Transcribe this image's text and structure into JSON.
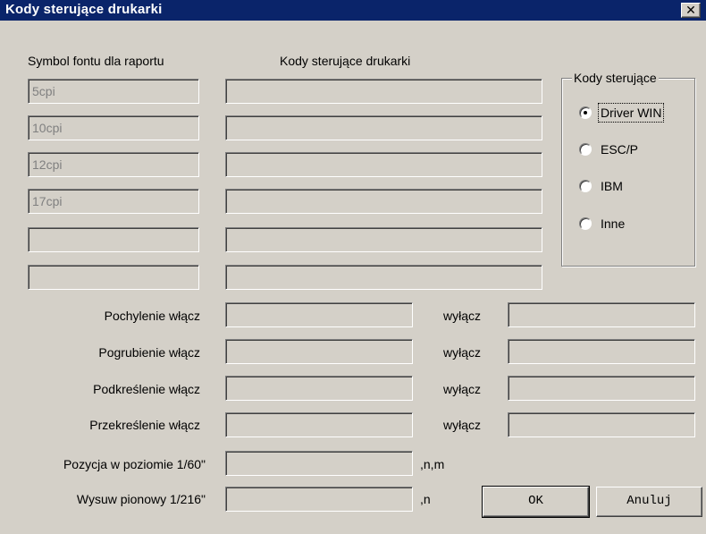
{
  "window": {
    "title": "Kody sterujące drukarki",
    "close_glyph": "✕"
  },
  "headers": {
    "symbol_col": "Symbol fontu dla raportu",
    "codes_col": "Kody sterujące drukarki"
  },
  "font_rows": [
    {
      "symbol": "5cpi",
      "code": ""
    },
    {
      "symbol": "10cpi",
      "code": ""
    },
    {
      "symbol": "12cpi",
      "code": ""
    },
    {
      "symbol": "17cpi",
      "code": ""
    },
    {
      "symbol": "",
      "code": ""
    },
    {
      "symbol": "",
      "code": ""
    }
  ],
  "control_group": {
    "legend": "Kody sterujące",
    "options": [
      {
        "label": "Driver WIN",
        "selected": true
      },
      {
        "label": "ESC/P",
        "selected": false
      },
      {
        "label": "IBM",
        "selected": false
      },
      {
        "label": "Inne",
        "selected": false
      }
    ]
  },
  "styles": [
    {
      "label": "Pochylenie włącz",
      "on": "",
      "off_label": "wyłącz",
      "off": ""
    },
    {
      "label": "Pogrubienie włącz",
      "on": "",
      "off_label": "wyłącz",
      "off": ""
    },
    {
      "label": "Podkreślenie włącz",
      "on": "",
      "off_label": "wyłącz",
      "off": ""
    },
    {
      "label": "Przekreślenie włącz",
      "on": "",
      "off_label": "wyłącz",
      "off": ""
    }
  ],
  "positioning": [
    {
      "label": "Pozycja w poziomie 1/60\"",
      "value": "",
      "suffix": ",n,m"
    },
    {
      "label": "Wysuw pionowy 1/216\"",
      "value": "",
      "suffix": ",n"
    }
  ],
  "buttons": {
    "ok": "OK",
    "cancel": "Anuluj"
  }
}
